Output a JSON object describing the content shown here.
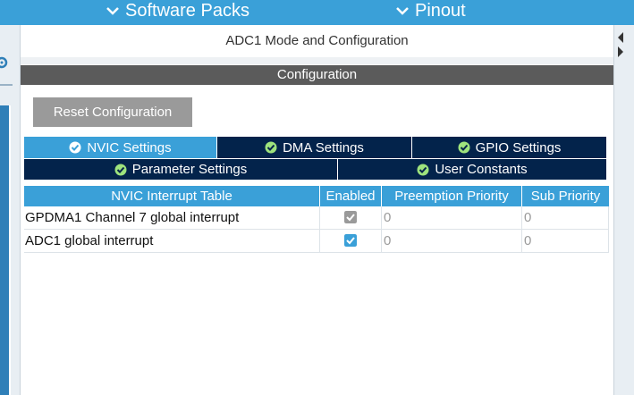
{
  "topbar": {
    "software_packs": "Software Packs",
    "pinout": "Pinout"
  },
  "mode_header": "ADC1 Mode and Configuration",
  "configuration_header": "Configuration",
  "reset_button": "Reset Configuration",
  "tabs": [
    {
      "label": "NVIC Settings",
      "active": true
    },
    {
      "label": "DMA Settings",
      "active": false
    },
    {
      "label": "GPIO Settings",
      "active": false
    },
    {
      "label": "Parameter Settings",
      "active": false
    },
    {
      "label": "User Constants",
      "active": false
    }
  ],
  "table": {
    "headers": [
      "NVIC Interrupt Table",
      "Enabled",
      "Preemption Priority",
      "Sub Priority"
    ],
    "rows": [
      {
        "name": "GPDMA1 Channel 7 global interrupt",
        "enabled": true,
        "enabled_editable": false,
        "preemption": "0",
        "sub": "0"
      },
      {
        "name": "ADC1 global interrupt",
        "enabled": true,
        "enabled_editable": true,
        "preemption": "0",
        "sub": "0"
      }
    ]
  },
  "colors": {
    "accent": "#3aa0d8",
    "tab_dark": "#03234b",
    "header_gray": "#5b5b5b",
    "check_enabled": "#3aa0d8",
    "check_disabled": "#9a9a9a"
  },
  "icons": {
    "tab_check": "check-circle-icon",
    "menu_chevron": "chevron-down-icon"
  }
}
